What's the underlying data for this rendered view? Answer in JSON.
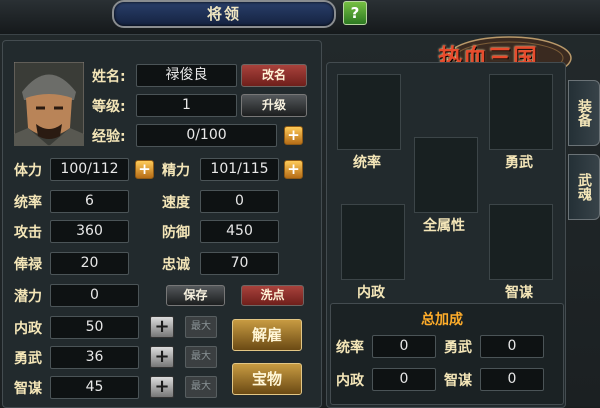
{
  "window": {
    "title": "将领",
    "help": "?"
  },
  "logo": {
    "text": "热血三国"
  },
  "tabs": [
    "装备",
    "武魂"
  ],
  "hero": {
    "name_label": "姓名:",
    "name": "禄俊良",
    "rename": "改名",
    "level_label": "等级:",
    "level": "1",
    "upgrade": "升级",
    "exp_label": "经验:",
    "exp": "0/100"
  },
  "stats": {
    "hp_label": "体力",
    "hp": "100/112",
    "energy_label": "精力",
    "energy": "101/115",
    "command_label": "统率",
    "command": "6",
    "speed_label": "速度",
    "speed": "0",
    "attack_label": "攻击",
    "attack": "360",
    "defense_label": "防御",
    "defense": "450",
    "salary_label": "俸禄",
    "salary": "20",
    "loyalty_label": "忠诚",
    "loyalty": "70",
    "potential_label": "潜力",
    "potential": "0",
    "save": "保存",
    "reset": "洗点",
    "politics_label": "内政",
    "politics": "50",
    "bravery_label": "勇武",
    "bravery": "36",
    "wisdom_label": "智谋",
    "wisdom": "45",
    "max": "最大",
    "dismiss": "解雇",
    "treasure": "宝物"
  },
  "slots": {
    "command": "统率",
    "bravery": "勇武",
    "all": "全属性",
    "politics": "内政",
    "wisdom": "智谋"
  },
  "bonus": {
    "title": "总加成",
    "command_label": "统率",
    "command": "0",
    "bravery_label": "勇武",
    "bravery": "0",
    "politics_label": "内政",
    "politics": "0",
    "wisdom_label": "智谋",
    "wisdom": "0"
  },
  "colors": {
    "label": "#f4e6b8",
    "accent_red": "#a9423c",
    "gold": "#c89b42",
    "bonus_title": "#ffad2a"
  }
}
